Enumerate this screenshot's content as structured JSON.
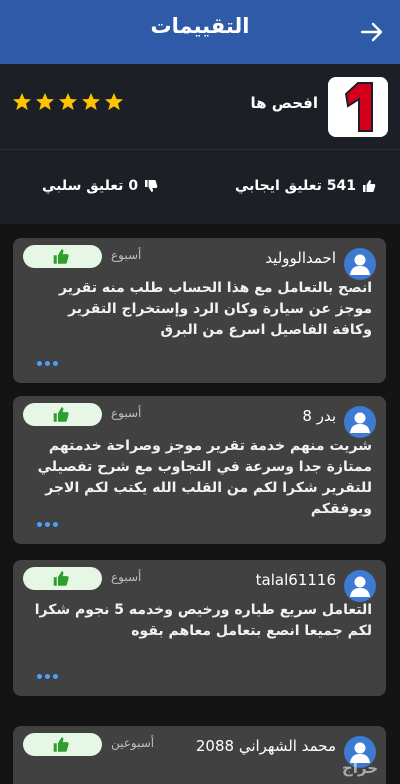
{
  "header": {
    "title": "التقييمات",
    "back_icon": "arrow-right-icon"
  },
  "profile": {
    "logo_icon": "number-one-logo",
    "name": "افحص ها",
    "rating_stars": 5,
    "star_color": "#ffc400"
  },
  "counts": {
    "positive_label": "541 تعليق ايجابي",
    "negative_label": "0 تعليق سلبي"
  },
  "reviews": [
    {
      "author": "احمدالووليد",
      "time": "أسبوع",
      "text": "انصح بالتعامل مع هذا الحساب طلب منه تقرير موجز عن سيارة وكان الرد وإستخراج التقرير وكافة الفاصيل اسرع من البرق"
    },
    {
      "author": "بدر 8",
      "time": "أسبوع",
      "text": "شريت منهم خدمة تقرير موجز وصراحة خدمتهم ممتازة جدا وسرعة في التجاوب مع شرح تفصيلي للتقرير شكرا لكم من القلب الله يكتب لكم الاجر ويوفقكم"
    },
    {
      "author": "talal61116",
      "time": "أسبوع",
      "text": "التعامل سريع طياره ورخيص وخدمه 5 نجوم شكرا لكم جميعا انصع بتعامل معاهم بقوه"
    },
    {
      "author": "محمد الشهراني 2088",
      "time": "أسبوعين",
      "text": ""
    }
  ],
  "colors": {
    "header": "#2f5aa8",
    "card": "#414141",
    "like_bg": "#e6f7e6",
    "like_icon": "#2e9e2e",
    "dots": "#4da0ff"
  },
  "watermark": "حراج"
}
